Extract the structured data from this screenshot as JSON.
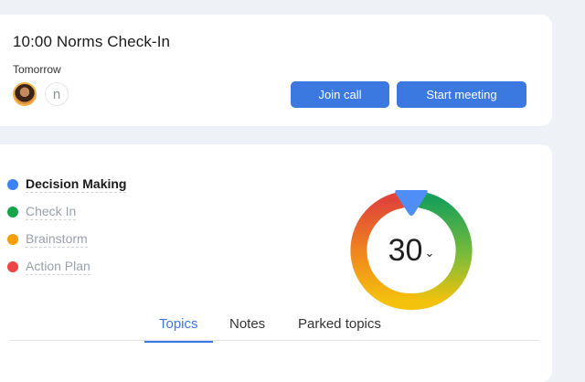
{
  "meeting": {
    "title": "10:00 Norms Check-In",
    "date_label": "Tomorrow",
    "participant_initial": "n",
    "join_label": "Join call",
    "start_label": "Start meeting"
  },
  "agenda": {
    "items": [
      {
        "label": "Decision Making",
        "color": "#3b82f6",
        "active": true
      },
      {
        "label": "Check In",
        "color": "#16a34a",
        "active": false
      },
      {
        "label": "Brainstorm",
        "color": "#f59e0b",
        "active": false
      },
      {
        "label": "Action Plan",
        "color": "#ef4444",
        "active": false
      }
    ]
  },
  "timer": {
    "value": "30",
    "caret_icon": "chevron-down-icon",
    "pointer_color": "#4f8ef7",
    "colors": {
      "green": "#19a058",
      "yellow": "#f4c20d",
      "orange": "#f59e0b",
      "red": "#e0443a"
    }
  },
  "tabs": {
    "items": [
      {
        "label": "Topics",
        "active": true
      },
      {
        "label": "Notes",
        "active": false
      },
      {
        "label": "Parked topics",
        "active": false
      }
    ]
  }
}
